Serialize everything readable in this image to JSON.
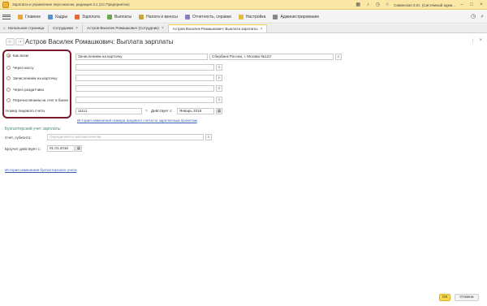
{
  "window": {
    "title": "Зарплата и управление персоналом, редакция 3.1 (1С:Предприятие)",
    "user": "Савинская З.Ю. (Системный адми..."
  },
  "sections": [
    {
      "label": "Главное",
      "color": "#e8a33a"
    },
    {
      "label": "Кадры",
      "color": "#5b8fc9"
    },
    {
      "label": "Зарплата",
      "color": "#e06a3a"
    },
    {
      "label": "Выплаты",
      "color": "#6aa84f"
    },
    {
      "label": "Налоги и взносы",
      "color": "#c9a63a"
    },
    {
      "label": "Отчетность, справки",
      "color": "#8e7cc3"
    },
    {
      "label": "Настройка",
      "color": "#e0c040"
    },
    {
      "label": "Администрирование",
      "color": "#888888"
    }
  ],
  "tabs": [
    {
      "label": "Начальная страница"
    },
    {
      "label": "Сотрудники"
    },
    {
      "label": "Астров Василек Ромашкович (Сотрудник)"
    },
    {
      "label": "Астров Василек Ромашкович: Выплата зарплаты"
    }
  ],
  "form": {
    "title": "Астров Василек Ромашкович: Выплата зарплаты",
    "payment_methods": [
      {
        "label": "Как всем",
        "selected": true
      },
      {
        "label": "Через кассу",
        "selected": false
      },
      {
        "label": "Зачислением на карточку",
        "selected": false
      },
      {
        "label": "Через раздатчика",
        "selected": false
      },
      {
        "label": "Перечислением на счет в банке",
        "selected": false
      }
    ],
    "method_fields": {
      "card_value": "Зачислением на карточку",
      "bank_value": "Сбербанк России, г. Москва №123"
    },
    "account": {
      "label": "Номер лицевого счета",
      "value": "11111",
      "help": "?",
      "effective_label": "Действует с:",
      "effective_value": "Январь 2018",
      "history_link": "История изменения номера лицевого счета по зарплатным проектам"
    },
    "accounting": {
      "group_title": "Бухгалтерский учет зарплаты",
      "account_label": "Счет, субконто:",
      "account_placeholder": "Определяется автоматически",
      "effective_label": "Бухучет действует с:",
      "effective_value": "01.01.2018",
      "history_link": "История изменения бухгалтерского учета"
    },
    "ok_label": "ОК",
    "cancel_label": "Отмена"
  }
}
